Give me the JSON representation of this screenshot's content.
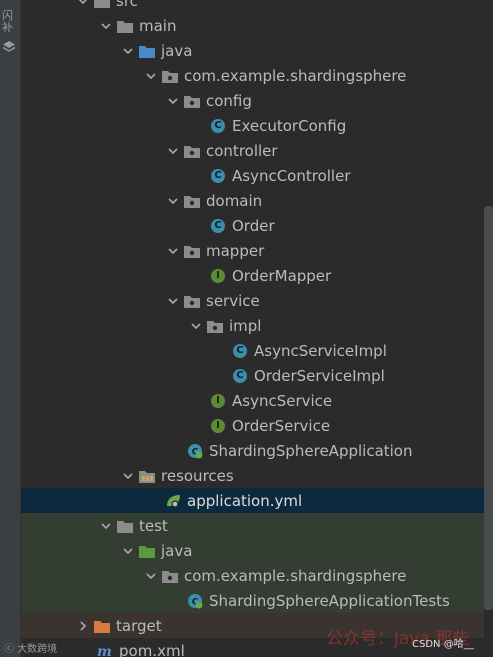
{
  "sidebar": {
    "vertical_label": "闪补",
    "footer_text": "大数跨境"
  },
  "tree": [
    {
      "label": "src",
      "kind": "folder",
      "expanded": true
    },
    {
      "label": "main",
      "kind": "folder",
      "expanded": true
    },
    {
      "label": "java",
      "kind": "source-root",
      "expanded": true
    },
    {
      "label": "com.example.shardingsphere",
      "kind": "package",
      "expanded": true
    },
    {
      "label": "config",
      "kind": "package",
      "expanded": true
    },
    {
      "label": "ExecutorConfig",
      "kind": "class"
    },
    {
      "label": "controller",
      "kind": "package",
      "expanded": true
    },
    {
      "label": "AsyncController",
      "kind": "class"
    },
    {
      "label": "domain",
      "kind": "package",
      "expanded": true
    },
    {
      "label": "Order",
      "kind": "class"
    },
    {
      "label": "mapper",
      "kind": "package",
      "expanded": true
    },
    {
      "label": "OrderMapper",
      "kind": "interface"
    },
    {
      "label": "service",
      "kind": "package",
      "expanded": true
    },
    {
      "label": "impl",
      "kind": "package",
      "expanded": true
    },
    {
      "label": "AsyncServiceImpl",
      "kind": "class"
    },
    {
      "label": "OrderServiceImpl",
      "kind": "class"
    },
    {
      "label": "AsyncService",
      "kind": "interface"
    },
    {
      "label": "OrderService",
      "kind": "interface"
    },
    {
      "label": "ShardingSphereApplication",
      "kind": "spring-class"
    },
    {
      "label": "resources",
      "kind": "resources-folder",
      "expanded": true
    },
    {
      "label": "application.yml",
      "kind": "yml",
      "selected": true
    },
    {
      "label": "test",
      "kind": "folder",
      "expanded": true
    },
    {
      "label": "java",
      "kind": "test-root",
      "expanded": true
    },
    {
      "label": "com.example.shardingsphere",
      "kind": "package",
      "expanded": true
    },
    {
      "label": "ShardingSphereApplicationTests",
      "kind": "spring-test-class"
    },
    {
      "label": "target",
      "kind": "excluded-folder",
      "expanded": false
    },
    {
      "label": "pom.xml",
      "kind": "maven"
    }
  ],
  "overlay": {
    "watermark": "公众号：Java 那些",
    "csdn_mark": "CSDN @哈__"
  },
  "colors": {
    "background": "#2b2b2b",
    "selection": "#0d293e",
    "test_band": "#333d32",
    "excluded_band": "#3b3330",
    "class_icon": "#3c8ead",
    "interface_icon": "#5e8a36"
  }
}
